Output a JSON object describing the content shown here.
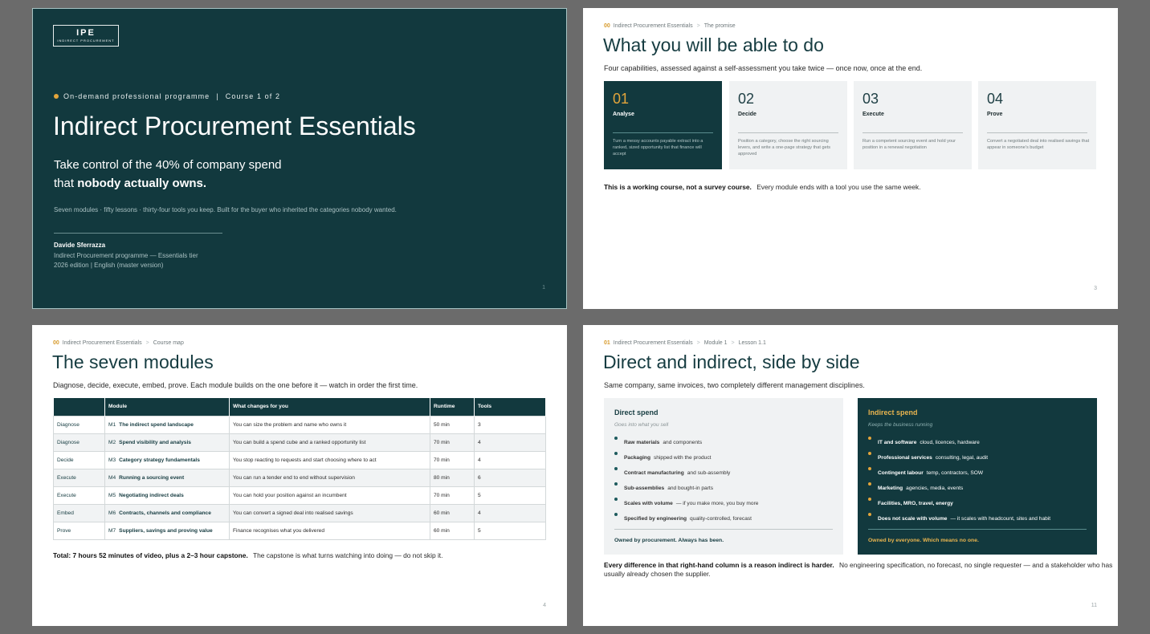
{
  "slide1": {
    "logo_big": "IPE",
    "logo_small": "INDIRECT PROCUREMENT",
    "kicker_left": "On-demand professional programme",
    "kicker_sep": "|",
    "kicker_right": "Course 1 of 2",
    "title": "Indirect Procurement Essentials",
    "tagline_1": "Take control of the 40% of company spend",
    "tagline_2_prefix": "that ",
    "tagline_2_bold": "nobody actually owns.",
    "strap": "Seven modules · fifty lessons · thirty-four tools you keep. Built for the buyer who inherited the categories nobody wanted.",
    "author": "Davide Sferrazza",
    "author_line1": "Indirect Procurement programme — Essentials tier",
    "author_line2": "2026 edition   |   English (master version)",
    "page": "1"
  },
  "slide2": {
    "crumb_num": "00",
    "crumb_1": "Indirect Procurement Essentials",
    "crumb_2": "The promise",
    "title": "What you will be able to do",
    "lead": "Four capabilities, assessed against a self-assessment you take twice — once now, once at the end.",
    "cards": [
      {
        "num": "01",
        "label": "Analyse",
        "desc": "Turn a messy accounts payable extract into a ranked, sized opportunity list that finance will accept"
      },
      {
        "num": "02",
        "label": "Decide",
        "desc": "Position a category, choose the right sourcing levers, and write a one-page strategy that gets approved"
      },
      {
        "num": "03",
        "label": "Execute",
        "desc": "Run a competent sourcing event and hold your position in a renewal negotiation"
      },
      {
        "num": "04",
        "label": "Prove",
        "desc": "Convert a negotiated deal into realised savings that appear in someone's budget"
      }
    ],
    "note_bold": "This is a working course, not a survey course.",
    "note_rest": "Every module ends with a tool you use the same week.",
    "page": "3"
  },
  "slide3": {
    "crumb_num": "00",
    "crumb_1": "Indirect Procurement Essentials",
    "crumb_2": "Course map",
    "title": "The seven modules",
    "lead": "Diagnose, decide, execute, embed, prove. Each module builds on the one before it — watch in order the first time.",
    "headers": [
      "",
      "Module",
      "What changes for you",
      "Runtime",
      "Tools"
    ],
    "rows": [
      {
        "phase": "Diagnose",
        "code": "M1",
        "module": "The indirect spend landscape",
        "change": "You can size the problem and name who owns it",
        "runtime": "50 min",
        "tools": "3"
      },
      {
        "phase": "Diagnose",
        "code": "M2",
        "module": "Spend visibility and analysis",
        "change": "You can build a spend cube and a ranked opportunity list",
        "runtime": "70 min",
        "tools": "4"
      },
      {
        "phase": "Decide",
        "code": "M3",
        "module": "Category strategy fundamentals",
        "change": "You stop reacting to requests and start choosing where to act",
        "runtime": "70 min",
        "tools": "4"
      },
      {
        "phase": "Execute",
        "code": "M4",
        "module": "Running a sourcing event",
        "change": "You can run a tender end to end without supervision",
        "runtime": "80 min",
        "tools": "6"
      },
      {
        "phase": "Execute",
        "code": "M5",
        "module": "Negotiating indirect deals",
        "change": "You can hold your position against an incumbent",
        "runtime": "70 min",
        "tools": "5"
      },
      {
        "phase": "Embed",
        "code": "M6",
        "module": "Contracts, channels and compliance",
        "change": "You can convert a signed deal into realised savings",
        "runtime": "60 min",
        "tools": "4"
      },
      {
        "phase": "Prove",
        "code": "M7",
        "module": "Suppliers, savings and proving value",
        "change": "Finance recognises what you delivered",
        "runtime": "60 min",
        "tools": "5"
      }
    ],
    "note_bold": "Total: 7 hours 52 minutes of video, plus a 2–3 hour capstone.",
    "note_rest": "The capstone is what turns watching into doing — do not skip it.",
    "page": "4"
  },
  "slide4": {
    "crumb_num": "01",
    "crumb_1": "Indirect Procurement Essentials",
    "crumb_2": "Module 1",
    "crumb_3": "Lesson 1.1",
    "title": "Direct and indirect, side by side",
    "lead": "Same company, same invoices, two completely different management disciplines.",
    "direct": {
      "heading": "Direct spend",
      "sub": "Goes into what you sell",
      "items": [
        {
          "bold": "Raw materials",
          "rest": "and components"
        },
        {
          "bold": "Packaging",
          "rest": "shipped with the product"
        },
        {
          "bold": "Contract manufacturing",
          "rest": "and sub-assembly"
        },
        {
          "bold": "Sub-assemblies",
          "rest": "and bought-in parts"
        },
        {
          "bold": "Scales with volume",
          "rest": "— if you make more, you buy more"
        },
        {
          "bold": "Specified by engineering",
          "rest": "quality-controlled, forecast"
        }
      ],
      "footer": "Owned by procurement. Always has been."
    },
    "indirect": {
      "heading": "Indirect spend",
      "sub": "Keeps the business running",
      "items": [
        {
          "bold": "IT and software",
          "rest": "cloud, licences, hardware"
        },
        {
          "bold": "Professional services",
          "rest": "consulting, legal, audit"
        },
        {
          "bold": "Contingent labour",
          "rest": "temp, contractors, SOW"
        },
        {
          "bold": "Marketing",
          "rest": "agencies, media, events"
        },
        {
          "bold": "Facilities, MRO, travel, energy",
          "rest": ""
        },
        {
          "bold": "Does not scale with volume",
          "rest": "— it scales with headcount, sites and habit"
        }
      ],
      "footer": "Owned by everyone. Which means no one."
    },
    "note_bold": "Every difference in that right-hand column is a reason indirect is harder.",
    "note_rest_1": "No engineering specification, no forecast, no single requester — and a stakeholder who has",
    "note_rest_2": "usually already chosen the supplier.",
    "page": "11"
  },
  "colors": {
    "brand_teal": "#12393e",
    "accent_gold": "#e3a53b"
  }
}
